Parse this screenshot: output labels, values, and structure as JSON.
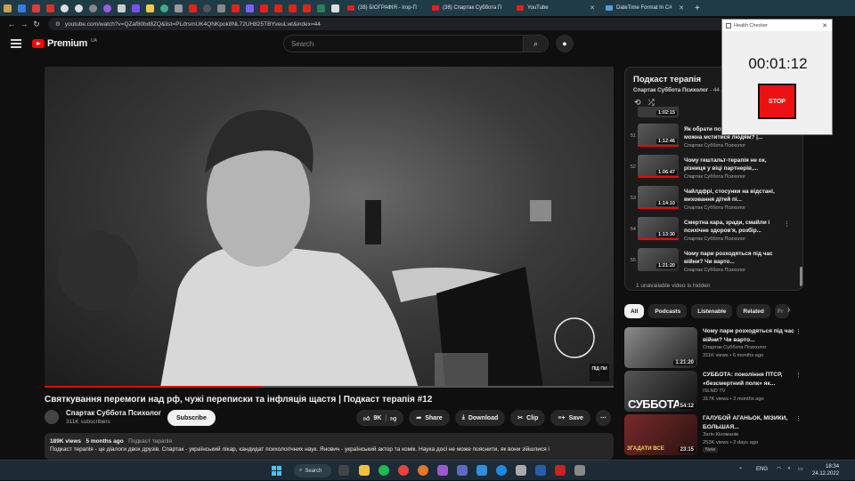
{
  "browser": {
    "tabs": [
      {
        "label": "(38) БІОГРАФІЯ - Ігор-П",
        "active": false
      },
      {
        "label": "(38) Спартак Суббота П",
        "active": true
      },
      {
        "label": "YouTube",
        "active": false
      },
      {
        "label": "DateTime Format In C#",
        "active": false
      }
    ],
    "new_tab": "+",
    "url": "youtube.com/watch?v=QZaf80bd8ZQ&list=PLdrsmUK4QNKpok8NL72UH825TBYveuLwt&index=44"
  },
  "header": {
    "logo_word": "Premium",
    "logo_region": "UA",
    "search_placeholder": "Search"
  },
  "video": {
    "title": "Святкування перемоги над рф, чужі переписки та інфляція щастя | Подкаст терапія #12",
    "progress": 0.38,
    "channel_name": "Спартак Суббота Психолог",
    "subscribers": "311K subscribers",
    "subscribe_label": "Subscribe",
    "likes": "9K",
    "share_label": "Share",
    "download_label": "Download",
    "clip_label": "Clip",
    "save_label": "Save",
    "more_label": "⋯",
    "views": "189K views",
    "age": "5 months ago",
    "playlist_link": "Подкаст терапія",
    "description": "Подкаст терапія - це діалоги двох друзів. Спартак - український лікар, кандидат психологічних наук. Янович - український актор та комік. Наука досі не може пояснити, як вони зійшлися і",
    "watermark": "ПІД ПИ"
  },
  "playlist": {
    "title": "Подкаст терапія",
    "owner": "Спартак Суббота Психолог",
    "position": "- 44 / 56",
    "partial_duration": "1:02:15",
    "items": [
      {
        "index": "51",
        "title": "Як обрати психотерапевта та можна мститися людям? |...",
        "channel": "Спартак Суббота Психолог",
        "duration": "1:12:46"
      },
      {
        "index": "52",
        "title": "Чому гештальт-терапія не ок, різниця у віці партнерів,...",
        "channel": "Спартак Суббота Психолог",
        "duration": "1:06:47"
      },
      {
        "index": "53",
        "title": "Чайлдфрі, стосунки на відстані, виховання дітей пі...",
        "channel": "Спартак Суббота Психолог",
        "duration": "1:14:10"
      },
      {
        "index": "54",
        "title": "Смертна кара, зради, смайли і психічне здоров'я, розбір...",
        "channel": "Спартак Суббота Психолог",
        "duration": "1:13:30"
      },
      {
        "index": "55",
        "title": "Чому пари розходяться під час війни? Чи варто...",
        "channel": "Спартак Суббота Психолог",
        "duration": "1:21:20"
      }
    ],
    "unavailable_note": "1 unavailable video is hidden"
  },
  "chips": [
    "All",
    "Podcasts",
    "Listenable",
    "Related",
    "Fr"
  ],
  "recommendations": [
    {
      "title": "Чому пари розходяться під час війни? Чи варто...",
      "channel": "Спартак Суббота Психолог",
      "stats": "311K views • 6 months ago",
      "duration": "1:21:20",
      "overlay": "",
      "badge": ""
    },
    {
      "title": "СУББОТА: покоління ПТСР, «безсмертний полк» як...",
      "channel": "ISLND TV",
      "stats": "317K views • 2 months ago",
      "duration": "54:12",
      "overlay": "СУББОТА",
      "badge": ""
    },
    {
      "title": "ГАЛУБОЙ АГАНЬОК, МІЗИКИ, БОЛЬШАЯ...",
      "channel": "Загін Кіноманів",
      "stats": "253K views • 2 days ago",
      "duration": "23:15",
      "overlay": "ЗГАДАТИ ВСЕ",
      "badge": "New"
    }
  ],
  "health_checker": {
    "title": "Health Checker",
    "elapsed": "00:01:12",
    "stop_label": "STOP"
  },
  "taskbar": {
    "search_label": "Search",
    "lang": "ENG",
    "time": "18:34",
    "date": "24.12.2022"
  },
  "colors": {
    "brand_red": "#ff0000",
    "stop_red": "#ee1111",
    "taskbar": "#1c2b35",
    "tabbar": "#1f3b46"
  }
}
